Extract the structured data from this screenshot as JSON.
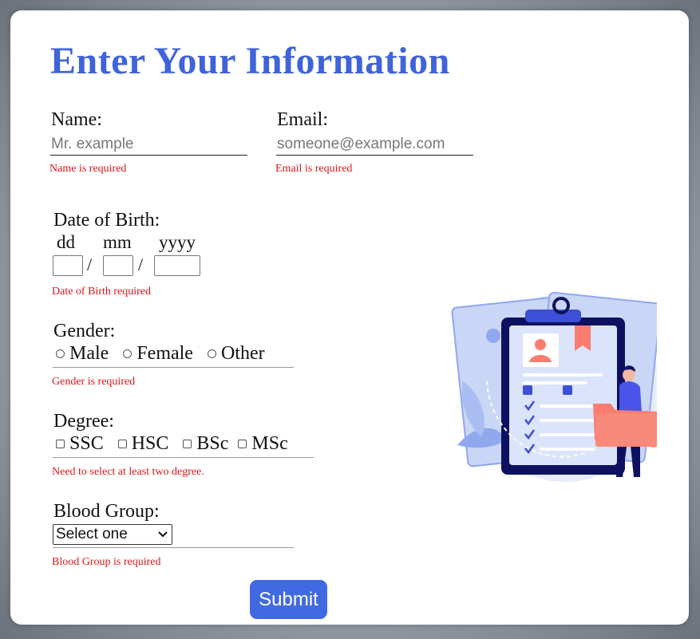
{
  "form": {
    "title": "Enter Your Information",
    "name": {
      "label": "Name:",
      "placeholder": "Mr. example",
      "error": "Name is required"
    },
    "email": {
      "label": "Email:",
      "placeholder": "someone@example.com",
      "error": "Email is required"
    },
    "dob": {
      "label": "Date of Birth:",
      "day_label": "dd",
      "month_label": "mm",
      "year_label": "yyyy",
      "separator": "/",
      "error": "Date of Birth required"
    },
    "gender": {
      "label": "Gender:",
      "options": [
        "Male",
        "Female",
        "Other"
      ],
      "error": "Gender is required"
    },
    "degree": {
      "label": "Degree:",
      "options": [
        "SSC",
        "HSC",
        "BSc",
        "MSc"
      ],
      "error": "Need to select at least two degree."
    },
    "blood_group": {
      "label": "Blood Group:",
      "selected": "Select one",
      "error": "Blood Group is required"
    },
    "submit_label": "Submit"
  },
  "illustration": {
    "icon": "clipboard-form-illustration"
  },
  "colors": {
    "accent": "#4169e1",
    "title": "#3f63d9",
    "error": "#e0151b"
  }
}
